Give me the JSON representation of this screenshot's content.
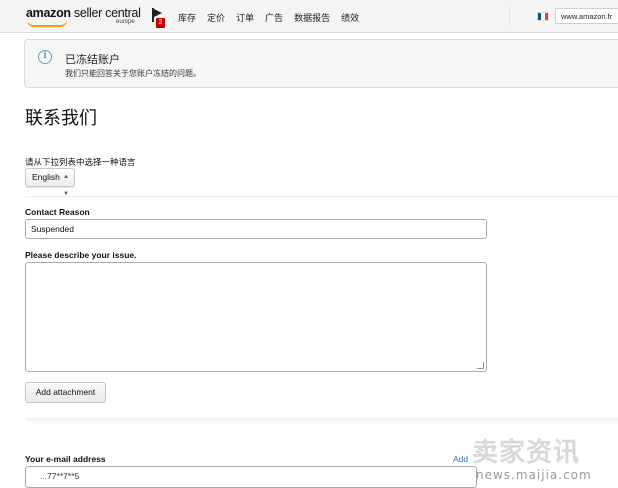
{
  "topbar": {
    "brand": "amazon",
    "brand_suffix": " seller central",
    "region": "europe",
    "notification_count": "2",
    "menu": [
      "库存",
      "定价",
      "订单",
      "广告",
      "数据报告",
      "绩效"
    ],
    "marketplace": "www.amazon.fr",
    "marketplace_flag_colors": [
      "#0055a4",
      "#ffffff",
      "#ef4135"
    ]
  },
  "alert": {
    "icon": "info-icon",
    "title": "已冻结账户",
    "description": "我们只能回答关于您账户冻结的问题。"
  },
  "page": {
    "title": "联系我们"
  },
  "language": {
    "label": "请从下拉列表中选择一种语言",
    "selected": "English"
  },
  "form": {
    "reason_label": "Contact Reason",
    "reason_value": "Suspended",
    "issue_label": "Please describe your issue.",
    "issue_value": "",
    "attach_button": "Add attachment",
    "email_label": "Your e-mail address",
    "email_add_link": "Add",
    "email_value": "...77**7**5"
  },
  "watermark": {
    "logo": "卖家资讯",
    "url": "news.maijia.com"
  },
  "colors": {
    "accent_orange": "#ff9900",
    "badge_red": "#c40000",
    "link_blue": "#2f6fb3"
  }
}
